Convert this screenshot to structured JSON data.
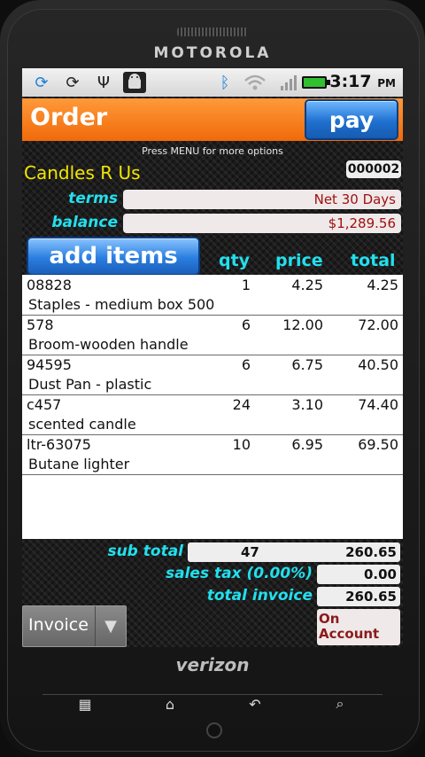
{
  "device": {
    "brand": "MOTOROLA",
    "carrier": "verizon"
  },
  "statusbar": {
    "icons": [
      "sync-blue-icon",
      "sync-icon",
      "usb-icon",
      "android-debug-icon",
      "bluetooth-icon",
      "wifi-icon",
      "signal-icon",
      "battery-icon"
    ],
    "time": "3:17",
    "ampm": "PM"
  },
  "header": {
    "title": "Order",
    "pay_label": "pay"
  },
  "hint": "Press MENU for more options",
  "customer": {
    "name": "Candles R Us",
    "order_number": "000002"
  },
  "fields": {
    "terms_label": "terms",
    "terms_value": "Net 30 Days",
    "balance_label": "balance",
    "balance_value": "$1,289.56"
  },
  "items_header": {
    "add_label": "add items",
    "qty": "qty",
    "price": "price",
    "total": "total"
  },
  "items": [
    {
      "code": "08828",
      "desc": "Staples - medium box 500",
      "qty": "1",
      "price": "4.25",
      "total": "4.25"
    },
    {
      "code": "578",
      "desc": "Broom-wooden handle",
      "qty": "6",
      "price": "12.00",
      "total": "72.00"
    },
    {
      "code": "94595",
      "desc": "Dust Pan - plastic",
      "qty": "6",
      "price": "6.75",
      "total": "40.50"
    },
    {
      "code": "c457",
      "desc": "scented candle",
      "qty": "24",
      "price": "3.10",
      "total": "74.40"
    },
    {
      "code": "ltr-63075",
      "desc": "Butane lighter",
      "qty": "10",
      "price": "6.95",
      "total": "69.50"
    }
  ],
  "totals": {
    "subtotal_label": "sub total",
    "subtotal_qty": "47",
    "subtotal_value": "260.65",
    "tax_label": "sales tax (0.00%)",
    "tax_value": "0.00",
    "invoice_label": "total invoice",
    "invoice_value": "260.65"
  },
  "footer": {
    "doc_type": "Invoice",
    "payment_line1": "On",
    "payment_line2": "Account"
  },
  "nav_keys": [
    "menu-icon",
    "home-icon",
    "back-icon",
    "search-icon"
  ]
}
